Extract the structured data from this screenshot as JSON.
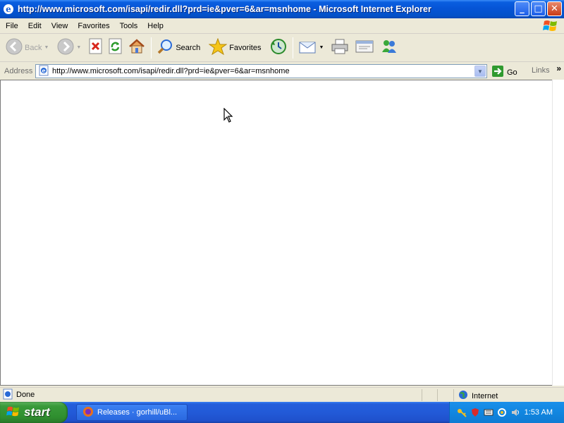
{
  "window": {
    "title": "http://www.microsoft.com/isapi/redir.dll?prd=ie&pver=6&ar=msnhome - Microsoft Internet Explorer",
    "controls": {
      "minimize": "_",
      "maximize": "□",
      "close": "✕"
    }
  },
  "menu": {
    "items": [
      "File",
      "Edit",
      "View",
      "Favorites",
      "Tools",
      "Help"
    ]
  },
  "toolbar": {
    "back_label": "Back",
    "search_label": "Search",
    "favorites_label": "Favorites"
  },
  "address": {
    "label": "Address",
    "url": "http://www.microsoft.com/isapi/redir.dll?prd=ie&pver=6&ar=msnhome",
    "go_label": "Go",
    "links_label": "Links",
    "chevron": "»"
  },
  "status": {
    "text": "Done",
    "zone": "Internet"
  },
  "taskbar": {
    "start_label": "start",
    "task_label": "Releases · gorhill/uBl...",
    "clock": "1:53 AM"
  }
}
